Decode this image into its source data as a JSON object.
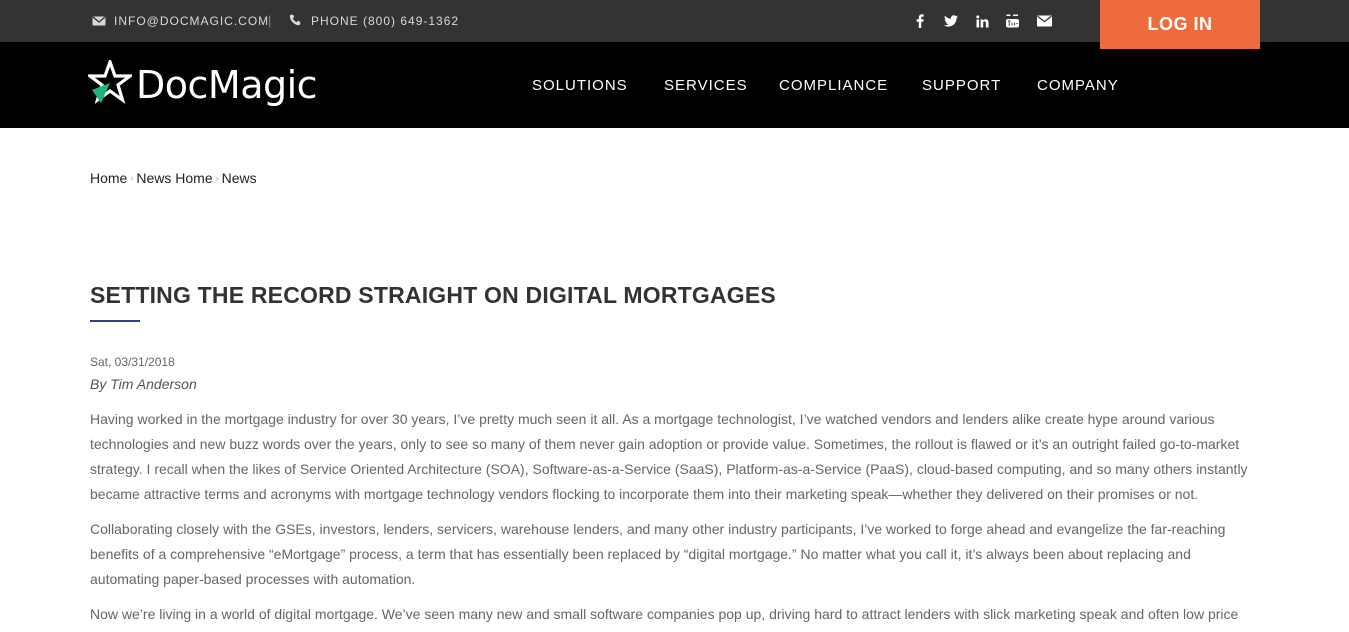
{
  "topbar": {
    "email": "INFO@DOCMAGIC.COM",
    "separator": "|",
    "phone": "PHONE (800) 649-1362",
    "social_icons": [
      "facebook-icon",
      "twitter-icon",
      "linkedin-icon",
      "youtube-icon",
      "envelope-icon"
    ],
    "login_label": "LOG IN"
  },
  "brand": {
    "name": "DocMagic",
    "accent_color": "#1db57a",
    "login_color": "#ee6c3c",
    "underline_color": "#2e3d8f"
  },
  "nav": {
    "items": [
      "SOLUTIONS",
      "SERVICES",
      "COMPLIANCE",
      "SUPPORT",
      "COMPANY"
    ]
  },
  "breadcrumb": {
    "items": [
      "Home",
      "News Home",
      "News"
    ]
  },
  "article": {
    "title": "SETTING THE RECORD STRAIGHT ON DIGITAL MORTGAGES",
    "date": "Sat, 03/31/2018",
    "author": "By Tim Anderson",
    "paragraphs": [
      "Having worked in the mortgage industry for over 30 years, I’ve pretty much seen it all. As a mortgage technologist, I’ve watched vendors and lenders alike create hype around various technologies and new buzz words over the years, only to see so many of them never gain adoption or provide value. Sometimes, the rollout is flawed or it’s an outright failed go-to-market strategy. I recall when the likes of Service Oriented Architecture (SOA), Software-as-a-Service (SaaS), Platform-as-a-Service (PaaS), cloud-based computing, and so many others instantly became attractive terms and acronyms with mortgage technology vendors flocking to incorporate them into their marketing speak—whether they delivered on their promises or not.",
      "Collaborating closely with the GSEs, investors, lenders, servicers, warehouse lenders, and many other industry participants, I’ve worked to forge ahead and evangelize the far-reaching benefits of a comprehensive “eMortgage” process, a term that has essentially been replaced by “digital mortgage.”  No matter what you call it, it’s always been about replacing and automating paper-based processes with automation.",
      "Now we’re living in a world of digital mortgage. We’ve seen many new and small software companies pop up, driving hard to attract lenders with slick marketing speak and often low price"
    ]
  }
}
